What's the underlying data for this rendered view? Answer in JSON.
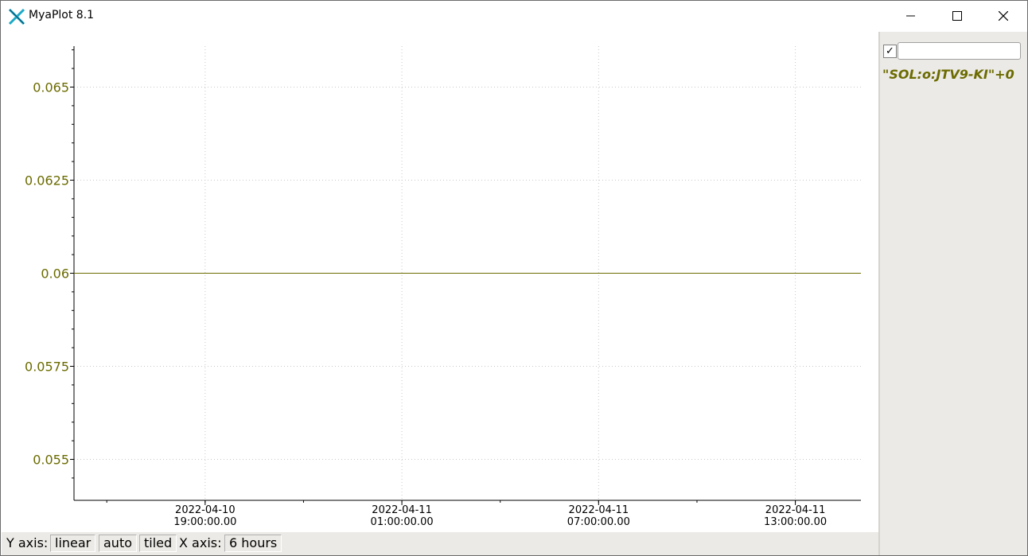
{
  "window": {
    "title": "MyaPlot 8.1"
  },
  "chart_data": {
    "type": "line",
    "y_ticks": [
      "0.065",
      "0.0625",
      "0.06",
      "0.0575",
      "0.055"
    ],
    "y_tick_values": [
      0.065,
      0.0625,
      0.06,
      0.0575,
      0.055
    ],
    "ylim": [
      0.0539,
      0.0661
    ],
    "x_ticks": [
      {
        "date": "2022-04-10",
        "time": "19:00:00.00"
      },
      {
        "date": "2022-04-11",
        "time": "01:00:00.00"
      },
      {
        "date": "2022-04-11",
        "time": "07:00:00.00"
      },
      {
        "date": "2022-04-11",
        "time": "13:00:00.00"
      }
    ],
    "xlim": [
      "2022-04-10 15:00",
      "2022-04-11 15:00"
    ],
    "series": [
      {
        "name": "\"SOL:o:JTV9-KI\"+0",
        "color": "#6b6b00",
        "x": [
          "2022-04-10 15:00",
          "2022-04-11 15:00"
        ],
        "values": [
          0.06,
          0.06
        ]
      }
    ],
    "grid": true,
    "grid_style": "dotted",
    "text_color": "#6b6b00"
  },
  "status_bar": {
    "y_axis_label": "Y axis:",
    "y_scale": "linear",
    "y_range": "auto",
    "layout": "tiled",
    "x_axis_label": "X axis:",
    "x_span": "6 hours"
  },
  "legend": {
    "checked": true,
    "checkmark": "✓",
    "input_value": "",
    "series_label": "\"SOL:o:JTV9-KI\"+0"
  }
}
